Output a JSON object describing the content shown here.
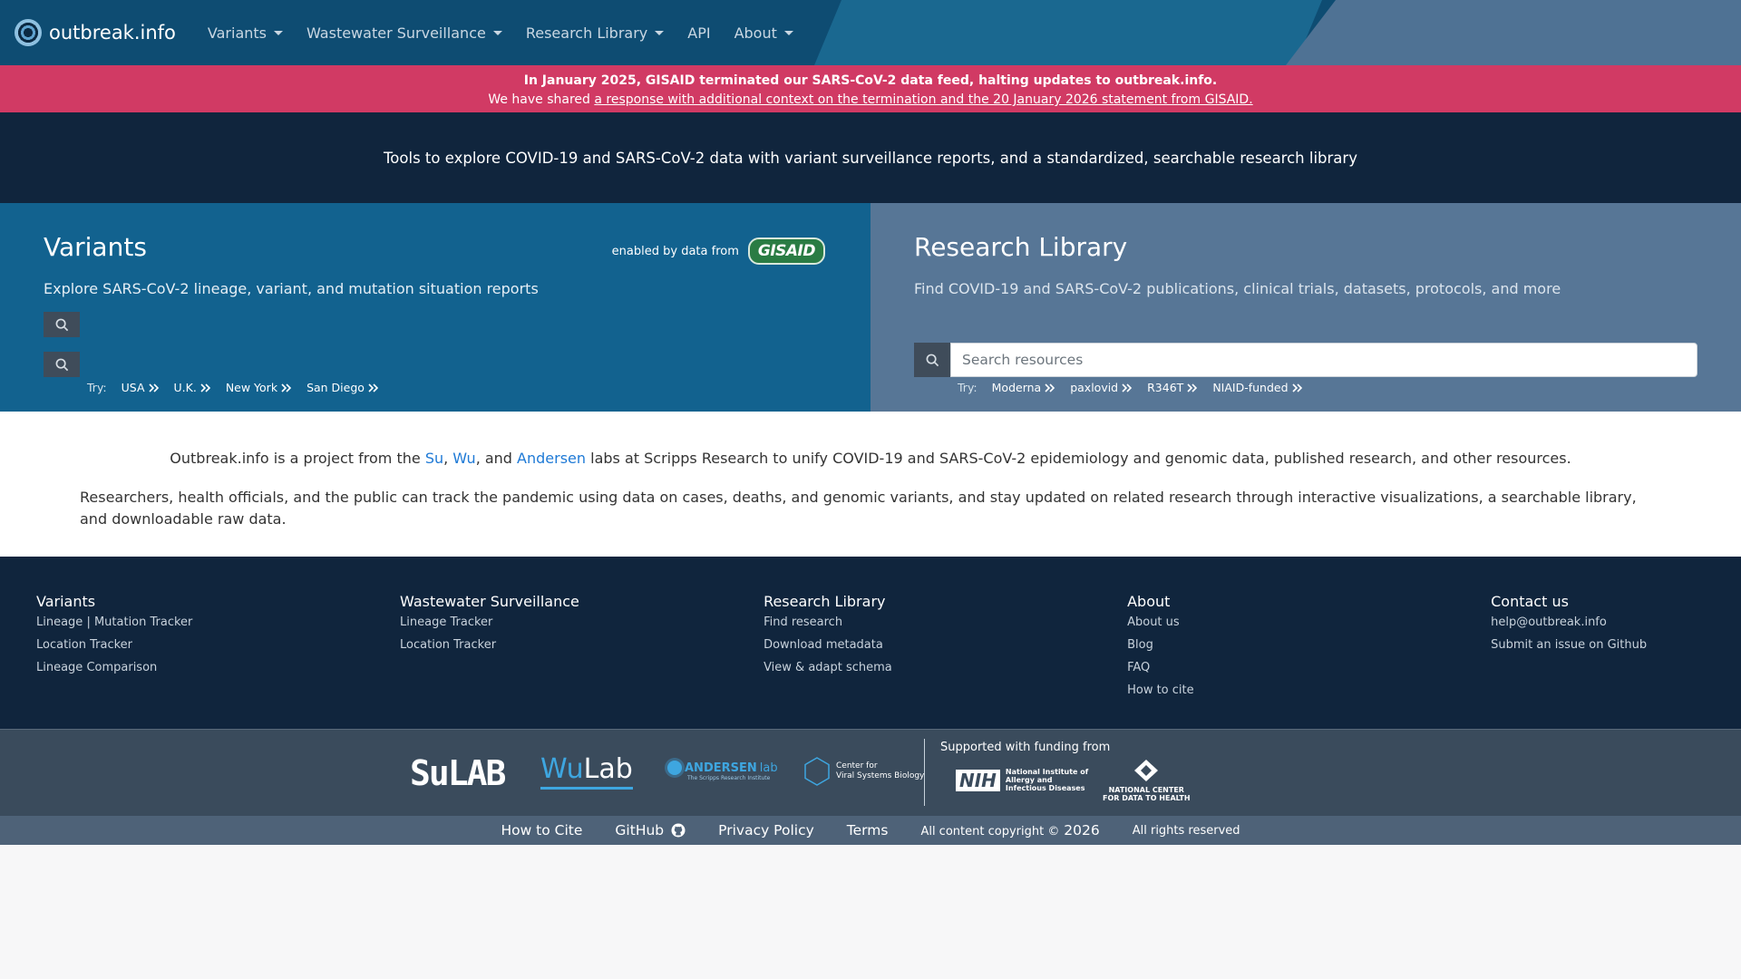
{
  "nav": {
    "brand": "outbreak.info",
    "items": [
      {
        "label": "Variants",
        "dropdown": true
      },
      {
        "label": "Wastewater Surveillance",
        "dropdown": true
      },
      {
        "label": "Research Library",
        "dropdown": true
      },
      {
        "label": "API",
        "dropdown": false
      },
      {
        "label": "About",
        "dropdown": true
      }
    ]
  },
  "alert": {
    "line1": "In January 2025, GISAID terminated our SARS-CoV-2 data feed, halting updates to outbreak.info.",
    "line2_prefix": "We have shared ",
    "line2_link": "a response with additional context on the termination and the 20 January 2026 statement from GISAID."
  },
  "hero": {
    "tagline": "Tools to explore COVID-19 and SARS-CoV-2 data with variant surveillance reports, and a standardized, searchable research library"
  },
  "variants_panel": {
    "title": "Variants",
    "enabled_by": "enabled by data from",
    "badge": "GISAID",
    "description": "Explore SARS-CoV-2 lineage, variant, and mutation situation reports",
    "try_label": "Try:",
    "try_items": [
      "USA",
      "U.K.",
      "New York",
      "San Diego"
    ]
  },
  "research_panel": {
    "title": "Research Library",
    "description": "Find COVID-19 and SARS-CoV-2 publications, clinical trials, datasets, protocols, and more",
    "search_placeholder": "Search resources",
    "try_label": "Try:",
    "try_items": [
      "Moderna",
      "paxlovid",
      "R346T",
      "NIAID-funded"
    ]
  },
  "about": {
    "line1_prefix": "Outbreak.info is a project from the ",
    "lab_su": "Su",
    "sep1": ", ",
    "lab_wu": "Wu",
    "sep2": ", and ",
    "lab_andersen": "Andersen",
    "line1_suffix": " labs at Scripps Research to unify COVID-19 and SARS-CoV-2 epidemiology and genomic data, published research, and other resources.",
    "line2": "Researchers, health officials, and the public can track the pandemic using data on cases, deaths, and genomic variants, and stay updated on related research through interactive visualizations, a searchable library, and downloadable raw data."
  },
  "footer": {
    "columns": [
      {
        "title": "Variants",
        "links": [
          "Lineage | Mutation Tracker",
          "Location Tracker",
          "Lineage Comparison"
        ]
      },
      {
        "title": "Wastewater Surveillance",
        "links": [
          "Lineage Tracker",
          "Location Tracker"
        ]
      },
      {
        "title": "Research Library",
        "links": [
          "Find research",
          "Download metadata",
          "View & adapt schema"
        ]
      },
      {
        "title": "About",
        "links": [
          "About us",
          "Blog",
          "FAQ",
          "How to cite"
        ]
      },
      {
        "title": "Contact us",
        "links": [
          "help@outbreak.info",
          "Submit an issue on Github"
        ]
      }
    ]
  },
  "sponsors": {
    "sulab": "SuLAB",
    "wulab_a": "Wu",
    "wulab_b": "Lab",
    "andersen_a": "ANDERSEN",
    "andersen_b": "lab",
    "andersen_sub": "The Scripps Research Institute",
    "cvsb_line1": "Center for",
    "cvsb_line2": "Viral Systems Biology",
    "supported_label": "Supported with funding from",
    "nih": "NIH",
    "nih_line1": "National Institute of",
    "nih_line2": "Allergy and",
    "nih_line3": "Infectious Diseases",
    "ncdh_line1": "NATIONAL CENTER",
    "ncdh_line2": "FOR DATA TO HEALTH"
  },
  "bottom": {
    "how_to_cite": "How to Cite",
    "github": "GitHub",
    "privacy": "Privacy Policy",
    "terms": "Terms",
    "copyright_prefix": "All content copyright ©",
    "year": "2026",
    "rights": "All rights reserved"
  }
}
